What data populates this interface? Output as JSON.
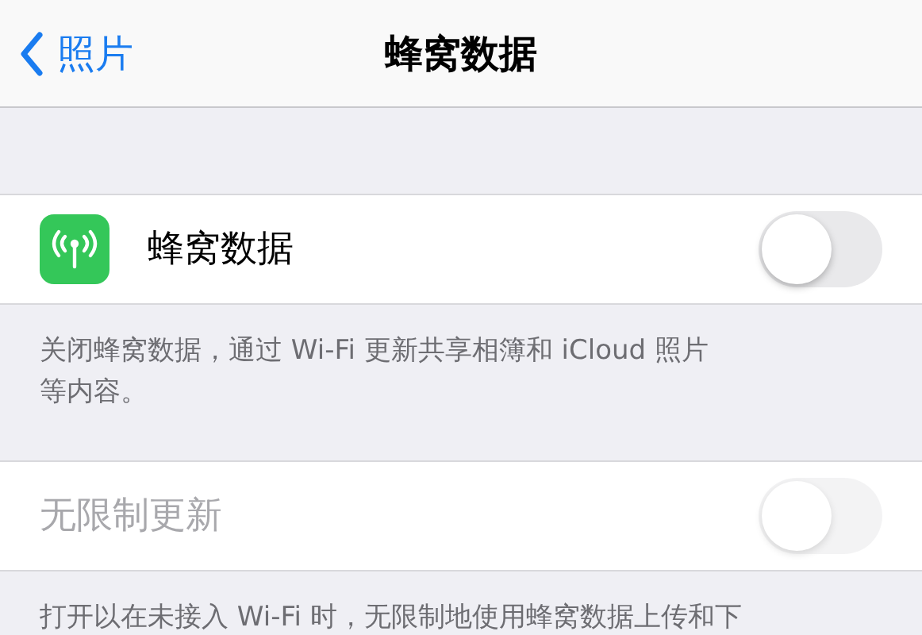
{
  "nav": {
    "back": "照片",
    "title": "蜂窝数据"
  },
  "sections": [
    {
      "row": {
        "label": "蜂窝数据",
        "icon": true,
        "on": false,
        "disabled": false
      },
      "footer": [
        "关闭蜂窝数据，通过 Wi-Fi 更新共享相簿和 iCloud 照片",
        "等内容。"
      ]
    },
    {
      "row": {
        "label": "无限制更新",
        "icon": false,
        "on": false,
        "disabled": true
      },
      "footer": [
        "打开以在未接入 Wi-Fi 时，无限制地使用蜂窝数据上传和下"
      ]
    }
  ]
}
